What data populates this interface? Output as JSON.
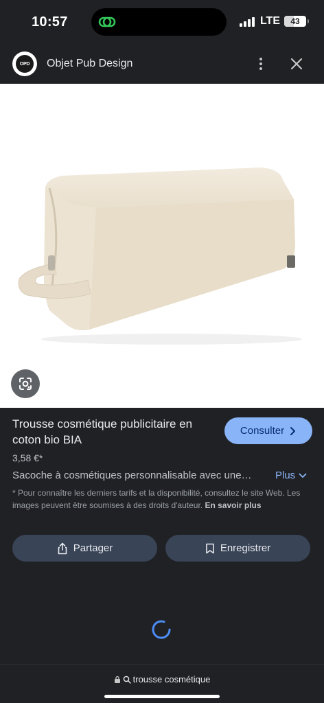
{
  "status_bar": {
    "time": "10:57",
    "network": "LTE",
    "battery": "43",
    "battery_level": 0.43
  },
  "header": {
    "logo_text": "OPD",
    "site_name": "Objet Pub Design"
  },
  "product": {
    "title": "Trousse cosmétique publicitaire en coton bio BIA",
    "price": "3,58 €*",
    "description": "Sacoche à cosmétiques personnalisable avec une…",
    "more_label": "Plus",
    "disclaimer": "* Pour connaître les derniers tarifs et la disponibilité, consultez le site Web. Les images peuvent être soumises à des droits d'auteur.",
    "learn_more": "En savoir plus"
  },
  "actions": {
    "consult_label": "Consulter",
    "share_label": "Partager",
    "save_label": "Enregistrer"
  },
  "bottom_bar": {
    "url": "trousse cosmétique"
  },
  "colors": {
    "background": "#202124",
    "accent": "#8ab4f8",
    "button_bg": "#394457",
    "spinner": "#4c8df6"
  },
  "icons": [
    "threads-icon",
    "signal-icon",
    "more-vert-icon",
    "close-icon",
    "google-lens-icon",
    "chevron-right-icon",
    "chevron-down-icon",
    "share-icon",
    "bookmark-icon",
    "loading-spinner",
    "lock-icon",
    "search-icon"
  ]
}
